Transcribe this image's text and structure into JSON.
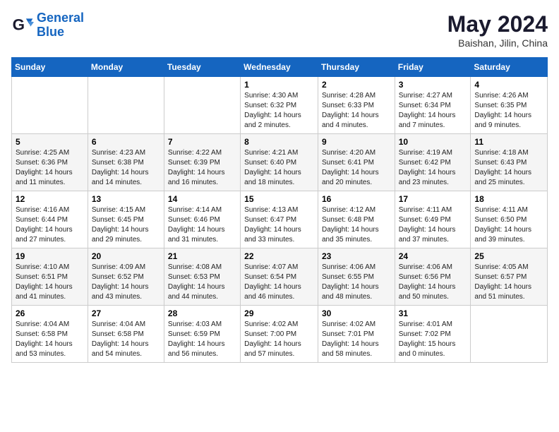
{
  "header": {
    "logo_general": "General",
    "logo_blue": "Blue",
    "month_title": "May 2024",
    "location": "Baishan, Jilin, China"
  },
  "days_of_week": [
    "Sunday",
    "Monday",
    "Tuesday",
    "Wednesday",
    "Thursday",
    "Friday",
    "Saturday"
  ],
  "weeks": [
    [
      {
        "day": "",
        "info": ""
      },
      {
        "day": "",
        "info": ""
      },
      {
        "day": "",
        "info": ""
      },
      {
        "day": "1",
        "info": "Sunrise: 4:30 AM\nSunset: 6:32 PM\nDaylight: 14 hours\nand 2 minutes."
      },
      {
        "day": "2",
        "info": "Sunrise: 4:28 AM\nSunset: 6:33 PM\nDaylight: 14 hours\nand 4 minutes."
      },
      {
        "day": "3",
        "info": "Sunrise: 4:27 AM\nSunset: 6:34 PM\nDaylight: 14 hours\nand 7 minutes."
      },
      {
        "day": "4",
        "info": "Sunrise: 4:26 AM\nSunset: 6:35 PM\nDaylight: 14 hours\nand 9 minutes."
      }
    ],
    [
      {
        "day": "5",
        "info": "Sunrise: 4:25 AM\nSunset: 6:36 PM\nDaylight: 14 hours\nand 11 minutes."
      },
      {
        "day": "6",
        "info": "Sunrise: 4:23 AM\nSunset: 6:38 PM\nDaylight: 14 hours\nand 14 minutes."
      },
      {
        "day": "7",
        "info": "Sunrise: 4:22 AM\nSunset: 6:39 PM\nDaylight: 14 hours\nand 16 minutes."
      },
      {
        "day": "8",
        "info": "Sunrise: 4:21 AM\nSunset: 6:40 PM\nDaylight: 14 hours\nand 18 minutes."
      },
      {
        "day": "9",
        "info": "Sunrise: 4:20 AM\nSunset: 6:41 PM\nDaylight: 14 hours\nand 20 minutes."
      },
      {
        "day": "10",
        "info": "Sunrise: 4:19 AM\nSunset: 6:42 PM\nDaylight: 14 hours\nand 23 minutes."
      },
      {
        "day": "11",
        "info": "Sunrise: 4:18 AM\nSunset: 6:43 PM\nDaylight: 14 hours\nand 25 minutes."
      }
    ],
    [
      {
        "day": "12",
        "info": "Sunrise: 4:16 AM\nSunset: 6:44 PM\nDaylight: 14 hours\nand 27 minutes."
      },
      {
        "day": "13",
        "info": "Sunrise: 4:15 AM\nSunset: 6:45 PM\nDaylight: 14 hours\nand 29 minutes."
      },
      {
        "day": "14",
        "info": "Sunrise: 4:14 AM\nSunset: 6:46 PM\nDaylight: 14 hours\nand 31 minutes."
      },
      {
        "day": "15",
        "info": "Sunrise: 4:13 AM\nSunset: 6:47 PM\nDaylight: 14 hours\nand 33 minutes."
      },
      {
        "day": "16",
        "info": "Sunrise: 4:12 AM\nSunset: 6:48 PM\nDaylight: 14 hours\nand 35 minutes."
      },
      {
        "day": "17",
        "info": "Sunrise: 4:11 AM\nSunset: 6:49 PM\nDaylight: 14 hours\nand 37 minutes."
      },
      {
        "day": "18",
        "info": "Sunrise: 4:11 AM\nSunset: 6:50 PM\nDaylight: 14 hours\nand 39 minutes."
      }
    ],
    [
      {
        "day": "19",
        "info": "Sunrise: 4:10 AM\nSunset: 6:51 PM\nDaylight: 14 hours\nand 41 minutes."
      },
      {
        "day": "20",
        "info": "Sunrise: 4:09 AM\nSunset: 6:52 PM\nDaylight: 14 hours\nand 43 minutes."
      },
      {
        "day": "21",
        "info": "Sunrise: 4:08 AM\nSunset: 6:53 PM\nDaylight: 14 hours\nand 44 minutes."
      },
      {
        "day": "22",
        "info": "Sunrise: 4:07 AM\nSunset: 6:54 PM\nDaylight: 14 hours\nand 46 minutes."
      },
      {
        "day": "23",
        "info": "Sunrise: 4:06 AM\nSunset: 6:55 PM\nDaylight: 14 hours\nand 48 minutes."
      },
      {
        "day": "24",
        "info": "Sunrise: 4:06 AM\nSunset: 6:56 PM\nDaylight: 14 hours\nand 50 minutes."
      },
      {
        "day": "25",
        "info": "Sunrise: 4:05 AM\nSunset: 6:57 PM\nDaylight: 14 hours\nand 51 minutes."
      }
    ],
    [
      {
        "day": "26",
        "info": "Sunrise: 4:04 AM\nSunset: 6:58 PM\nDaylight: 14 hours\nand 53 minutes."
      },
      {
        "day": "27",
        "info": "Sunrise: 4:04 AM\nSunset: 6:58 PM\nDaylight: 14 hours\nand 54 minutes."
      },
      {
        "day": "28",
        "info": "Sunrise: 4:03 AM\nSunset: 6:59 PM\nDaylight: 14 hours\nand 56 minutes."
      },
      {
        "day": "29",
        "info": "Sunrise: 4:02 AM\nSunset: 7:00 PM\nDaylight: 14 hours\nand 57 minutes."
      },
      {
        "day": "30",
        "info": "Sunrise: 4:02 AM\nSunset: 7:01 PM\nDaylight: 14 hours\nand 58 minutes."
      },
      {
        "day": "31",
        "info": "Sunrise: 4:01 AM\nSunset: 7:02 PM\nDaylight: 15 hours\nand 0 minutes."
      },
      {
        "day": "",
        "info": ""
      }
    ]
  ]
}
